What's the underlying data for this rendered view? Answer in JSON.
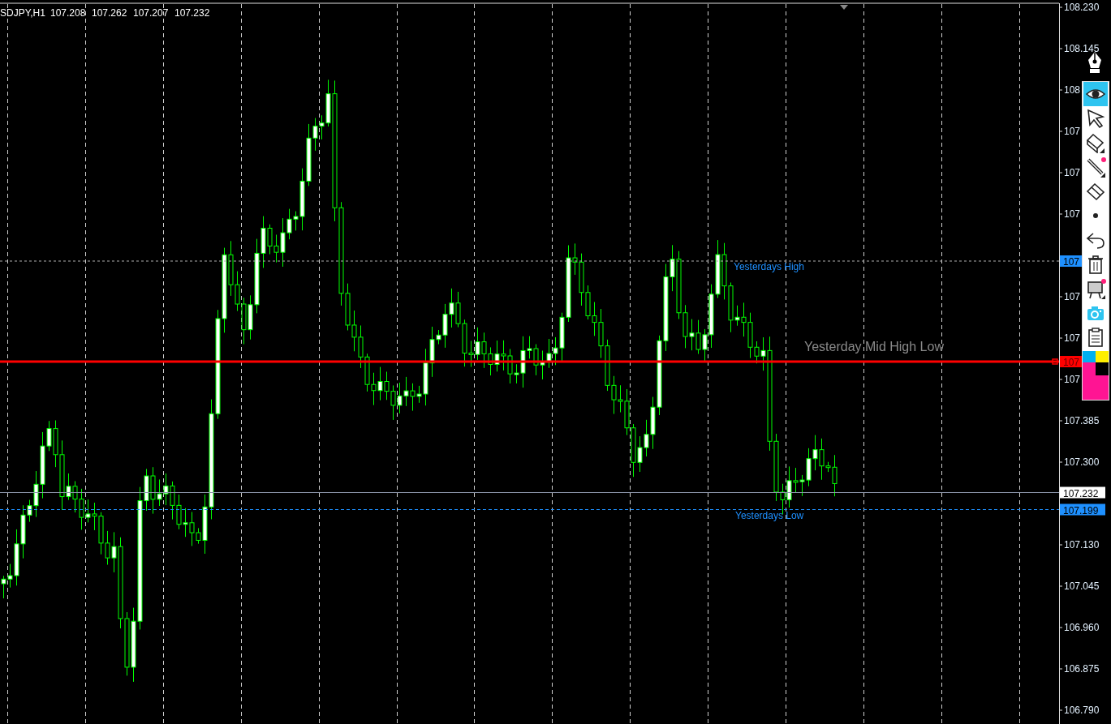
{
  "chart": {
    "symbol": "SDJPY,H1",
    "ohlc": [
      "107.208",
      "107.262",
      "107.207",
      "107.232"
    ],
    "price_axis": {
      "labels": [
        "108.230",
        "108.145",
        "108",
        "107",
        "107",
        "107",
        "107",
        "107",
        "107",
        "107.385",
        "107.300",
        "107.130",
        "107.045",
        "106.960",
        "106.875",
        "106.790"
      ]
    },
    "lines": [
      {
        "kind": "yesterday-high",
        "label": "Yesterdays High",
        "price_tag": "107"
      },
      {
        "kind": "mid",
        "label": "Yesterday Mid High Low",
        "price_tag": "107"
      },
      {
        "kind": "bid",
        "price_tag": "107.232"
      },
      {
        "kind": "yesterday-low",
        "label": "Yesterdays Low",
        "price_tag": "107.199"
      }
    ]
  },
  "toolbar": {
    "tools": [
      {
        "kind": "eye",
        "selected": true
      },
      {
        "kind": "cursor",
        "selected": false
      },
      {
        "kind": "box-eraser",
        "selected": false
      },
      {
        "kind": "line",
        "selected": false
      },
      {
        "kind": "eraser",
        "selected": false
      },
      {
        "kind": "dot",
        "selected": false
      },
      {
        "kind": "undo",
        "selected": false
      },
      {
        "kind": "trash",
        "selected": false
      },
      {
        "kind": "easel",
        "selected": false
      },
      {
        "kind": "camera",
        "selected": false
      },
      {
        "kind": "clipboard",
        "selected": false
      }
    ],
    "palette": [
      {
        "color": "#00b0f0"
      },
      {
        "color": "#ffee00"
      },
      {
        "color": "#ff1493"
      },
      {
        "color": "#000000"
      }
    ]
  }
}
